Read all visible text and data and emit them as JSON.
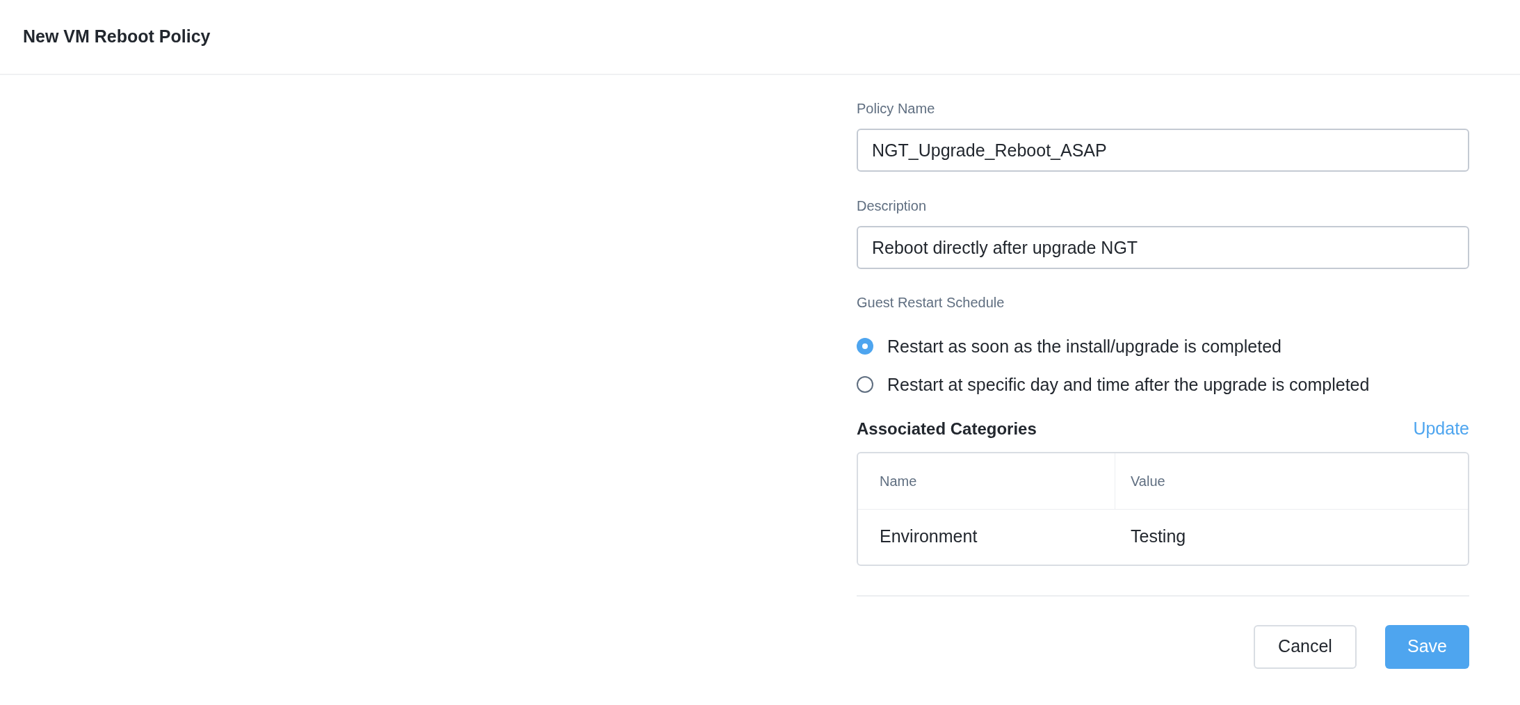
{
  "header": {
    "title": "New VM Reboot Policy"
  },
  "form": {
    "policy_name": {
      "label": "Policy Name",
      "value": "NGT_Upgrade_Reboot_ASAP"
    },
    "description": {
      "label": "Description",
      "value": "Reboot directly after upgrade NGT"
    },
    "schedule": {
      "label": "Guest Restart Schedule",
      "options": [
        {
          "label": "Restart as soon as the install/upgrade is completed",
          "selected": true
        },
        {
          "label": "Restart at specific day and time after the upgrade is completed",
          "selected": false
        }
      ]
    }
  },
  "categories": {
    "title": "Associated Categories",
    "action": "Update",
    "columns": [
      "Name",
      "Value"
    ],
    "rows": [
      [
        "Environment",
        "Testing"
      ]
    ]
  },
  "buttons": {
    "cancel": "Cancel",
    "save": "Save"
  }
}
